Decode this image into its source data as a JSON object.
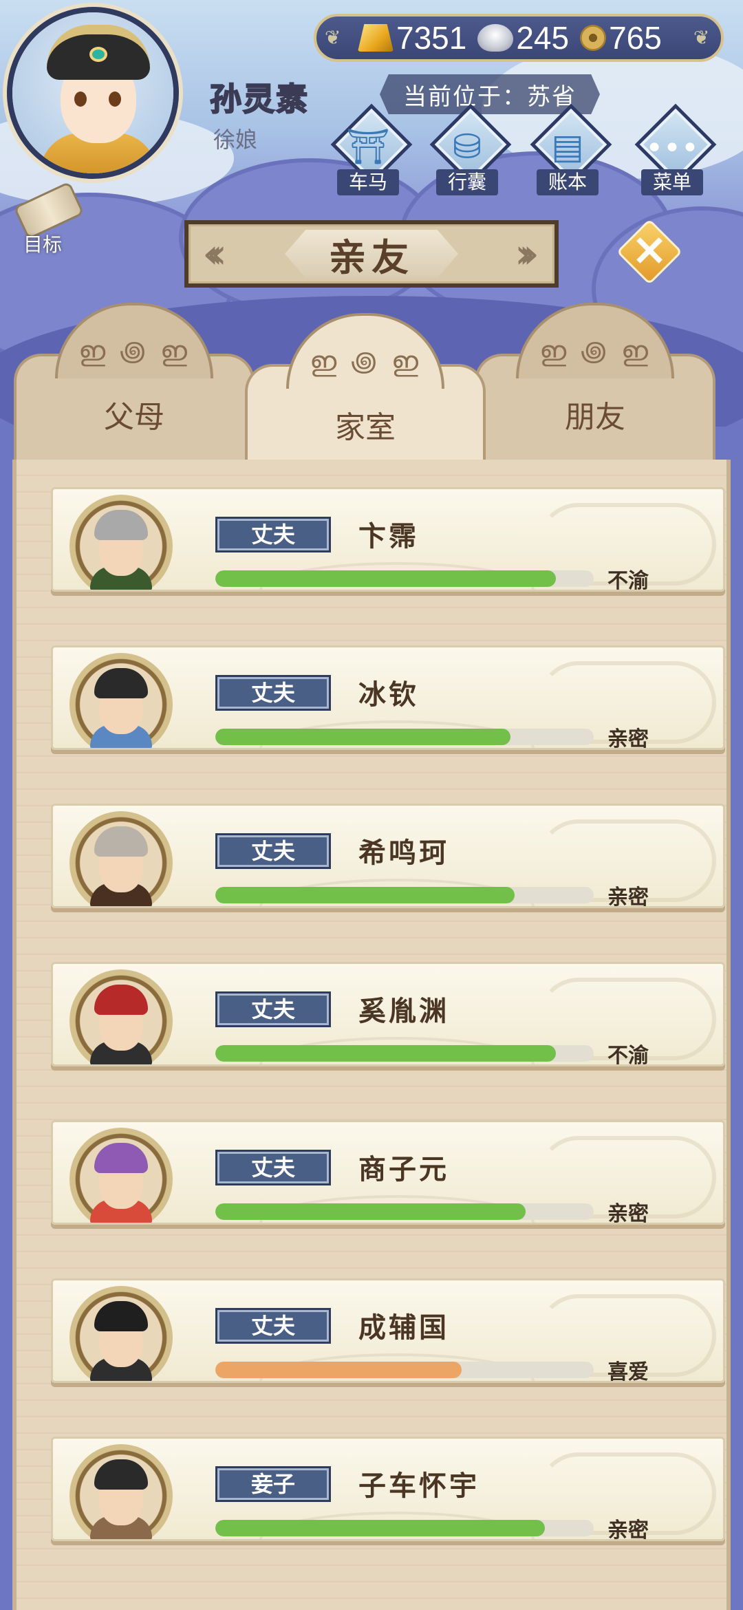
{
  "currency": {
    "gold": "7351",
    "silver": "245",
    "coin": "765"
  },
  "player": {
    "name": "孙灵素",
    "title": "徐娘",
    "location": "当前位于：苏省"
  },
  "menu": [
    {
      "label": "车马",
      "icon": "carriage-icon"
    },
    {
      "label": "行囊",
      "icon": "bag-icon"
    },
    {
      "label": "账本",
      "icon": "ledger-icon"
    },
    {
      "label": "菜单",
      "icon": "more-icon"
    }
  ],
  "goal_label": "目标",
  "banner_title": "亲友",
  "tabs": [
    {
      "label": "父母",
      "active": false
    },
    {
      "label": "家室",
      "active": true
    },
    {
      "label": "朋友",
      "active": false
    }
  ],
  "colors": {
    "bar_green": "#72c04a",
    "bar_orange": "#eda566",
    "tag_blue": "#4a5f86"
  },
  "relations": [
    {
      "tag": "丈夫",
      "name": "卞霈",
      "attitude": "不渝",
      "level": 0.9,
      "color": "#72c04a",
      "hair": "#a9a9a9",
      "robe": "#3b5a2e"
    },
    {
      "tag": "丈夫",
      "name": "冰钦",
      "attitude": "亲密",
      "level": 0.78,
      "color": "#72c04a",
      "hair": "#2a2a2a",
      "robe": "#5b87c2"
    },
    {
      "tag": "丈夫",
      "name": "希鸣珂",
      "attitude": "亲密",
      "level": 0.79,
      "color": "#72c04a",
      "hair": "#b8b2a8",
      "robe": "#4a3020"
    },
    {
      "tag": "丈夫",
      "name": "奚胤渊",
      "attitude": "不渝",
      "level": 0.9,
      "color": "#72c04a",
      "hair": "#b62a2a",
      "robe": "#2f2f2f"
    },
    {
      "tag": "丈夫",
      "name": "商子元",
      "attitude": "亲密",
      "level": 0.82,
      "color": "#72c04a",
      "hair": "#8e5ab3",
      "robe": "#d84a3a"
    },
    {
      "tag": "丈夫",
      "name": "成辅国",
      "attitude": "喜爱",
      "level": 0.65,
      "color": "#eda566",
      "hair": "#1f1f1f",
      "robe": "#2e2e2e"
    },
    {
      "tag": "妾子",
      "name": "子车怀宇",
      "attitude": "亲密",
      "level": 0.87,
      "color": "#72c04a",
      "hair": "#2a2a2a",
      "robe": "#8a6a4a"
    }
  ]
}
